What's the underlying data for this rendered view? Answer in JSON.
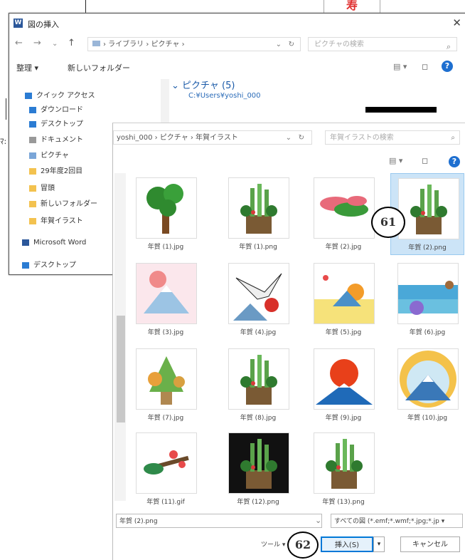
{
  "background": {
    "red_text": "寿",
    "side_text": "ﾏ:"
  },
  "dialog": {
    "title": "図の挿入",
    "address": "› ライブラリ › ピクチャ ›",
    "search_placeholder": "ピクチャの検索",
    "toolbar": {
      "organize": "整理 ▾",
      "new_folder": "新しいフォルダー"
    },
    "nav_items": [
      {
        "label": "クイック アクセス",
        "color": "#2b7cd3"
      },
      {
        "label": "ダウンロード",
        "color": "#2b7cd3"
      },
      {
        "label": "デスクトップ",
        "color": "#2b7cd3"
      },
      {
        "label": "ドキュメント",
        "color": "#999999"
      },
      {
        "label": "ピクチャ",
        "color": "#7aa6d8"
      },
      {
        "label": "29年度2回目",
        "color": "#f3c24f"
      },
      {
        "label": "冒頭",
        "color": "#f3c24f"
      },
      {
        "label": "新しいフォルダー",
        "color": "#f3c24f"
      },
      {
        "label": "年賀イラスト",
        "color": "#f3c24f"
      },
      {
        "label": "Microsoft Word",
        "color": "#2b579a"
      },
      {
        "label": "デスクトップ",
        "color": "#2b7cd3"
      }
    ],
    "section_header": "ピクチャ (5)",
    "section_path": "C:¥Users¥yoshi_000"
  },
  "front": {
    "address": "yoshi_000 › ピクチャ › 年賀イラスト",
    "search_placeholder": "年賀イラストの検索",
    "files": [
      {
        "name": "年賀 (1).jpg",
        "icon": "pine-tree-icon"
      },
      {
        "name": "年賀 (1).png",
        "icon": "kadomatsu-icon"
      },
      {
        "name": "年賀 (2).jpg",
        "icon": "pine-branch-icon"
      },
      {
        "name": "年賀 (2).png",
        "icon": "kadomatsu-icon",
        "selected": true
      },
      {
        "name": "年賀 (3).jpg",
        "icon": "fuji-icon"
      },
      {
        "name": "年賀 (4).jpg",
        "icon": "crane-icon"
      },
      {
        "name": "年賀 (5).jpg",
        "icon": "sunrise-icon"
      },
      {
        "name": "年賀 (6).jpg",
        "icon": "waves-icon"
      },
      {
        "name": "年賀 (7).jpg",
        "icon": "pine-icon"
      },
      {
        "name": "年賀 (8).jpg",
        "icon": "kadomatsu-icon"
      },
      {
        "name": "年賀 (9).jpg",
        "icon": "sun-mountain-icon"
      },
      {
        "name": "年賀 (10).jpg",
        "icon": "fuji-sun-icon"
      },
      {
        "name": "年賀 (11).gif",
        "icon": "plum-icon"
      },
      {
        "name": "年賀 (12).png",
        "icon": "kadomatsu-icon",
        "dark": true
      },
      {
        "name": "年賀 (13).png",
        "icon": "kadomatsu-icon"
      }
    ],
    "filename_value": "年賀 (2).png",
    "filetype_value": "すべての図 (*.emf;*.wmf;*.jpg;*.jp ▾",
    "tools_label": "ツール ▾",
    "insert_label": "挿入(S)",
    "cancel_label": "キャンセル"
  },
  "annotations": {
    "n61": "61",
    "n62": "62"
  }
}
